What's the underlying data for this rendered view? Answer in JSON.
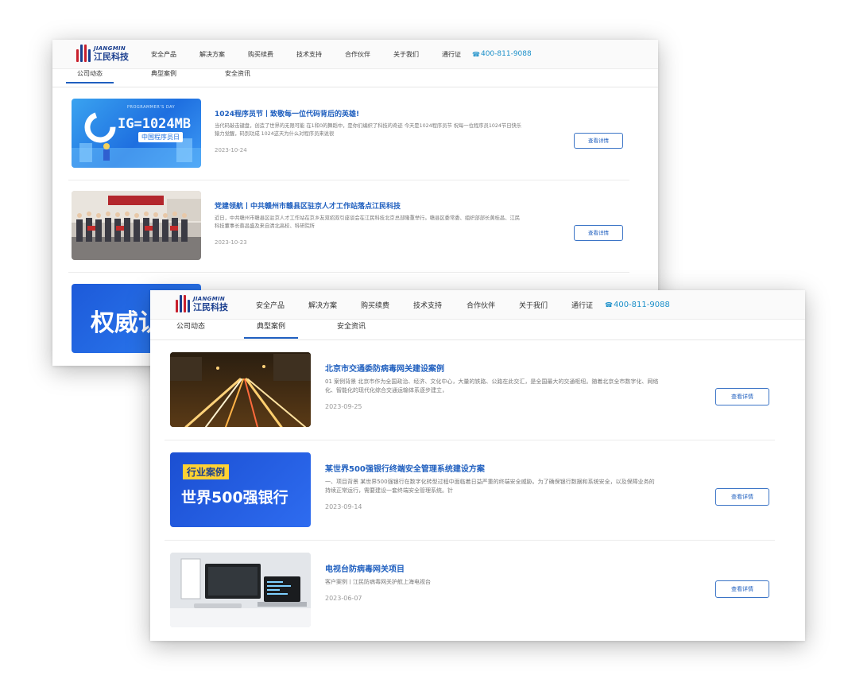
{
  "brand": {
    "name_en": "JIANGMIN",
    "name_cn": "江民科技"
  },
  "nav": {
    "items": [
      "安全产品",
      "解决方案",
      "购买续费",
      "技术支持",
      "合作伙伴",
      "关于我们",
      "通行证"
    ],
    "phone": "400-811-9088"
  },
  "tabs": [
    "公司动态",
    "典型案例",
    "安全资讯"
  ],
  "back_window": {
    "active_tab": "公司动态",
    "articles": [
      {
        "title": "1024程序员节丨致敬每一位代码背后的英雄!",
        "desc": "当代码敲击键盘，创造了世界的无限可能 在1和0的舞蹈中，是你们编织了科技的奇迹 今天是1024程序员节 祝每一位程序员1024节日快乐 猿力觉醒，码到功成 1024这天为什么对程序员来说很",
        "date": "2023-10-24",
        "button": "查看详情",
        "thumb": {
          "top": "PROGRAMMER'S DAY",
          "big": "IG=1024MB",
          "band": "中国程序员日"
        }
      },
      {
        "title": "党建领航丨中共赣州市赣县区驻京人才工作站落点江民科技",
        "desc": "近日，中共赣州市赣县区驻京人才工作站在京乡友双招双引座谈会在江民科技北京总部隆重举行。赣县区委常委、组织部部长黄桂昌、江民科技董事长蔡昌盛及来自清北高校、科研院所",
        "date": "2023-10-23",
        "button": "查看详情"
      },
      {
        "thumb_text": "权威认"
      }
    ]
  },
  "front_window": {
    "active_tab": "典型案例",
    "articles": [
      {
        "title": "北京市交通委防病毒网关建设案例",
        "desc": "01 案例背景 北京市作为全国政治、经济、文化中心，大量的铁路、公路在此交汇，是全国最大的交通枢纽。随着北京全市数字化、网络化、智能化的现代化综合交通运输体系逐步建立，",
        "date": "2023-09-25",
        "button": "查看详情"
      },
      {
        "title": "某世界500强银行终端安全管理系统建设方案",
        "desc": "一、项目背景 某世界500强银行在数字化转型过程中面临着日益严重的终端安全威胁。为了确保银行数据和系统安全，以及保障业务的持续正常运行，需要建设一套终端安全管理系统。针",
        "date": "2023-09-14",
        "button": "查看详情",
        "thumb": {
          "tag": "行业案例",
          "big": "世界500强银行"
        }
      },
      {
        "title": "电视台防病毒网关项目",
        "desc": "客户案例丨江民防病毒网关护航上海电视台",
        "date": "2023-06-07",
        "button": "查看详情"
      }
    ]
  },
  "colors": {
    "accent": "#1f5fbf",
    "brand_red": "#c8202c",
    "phone": "#1a8fc9"
  }
}
